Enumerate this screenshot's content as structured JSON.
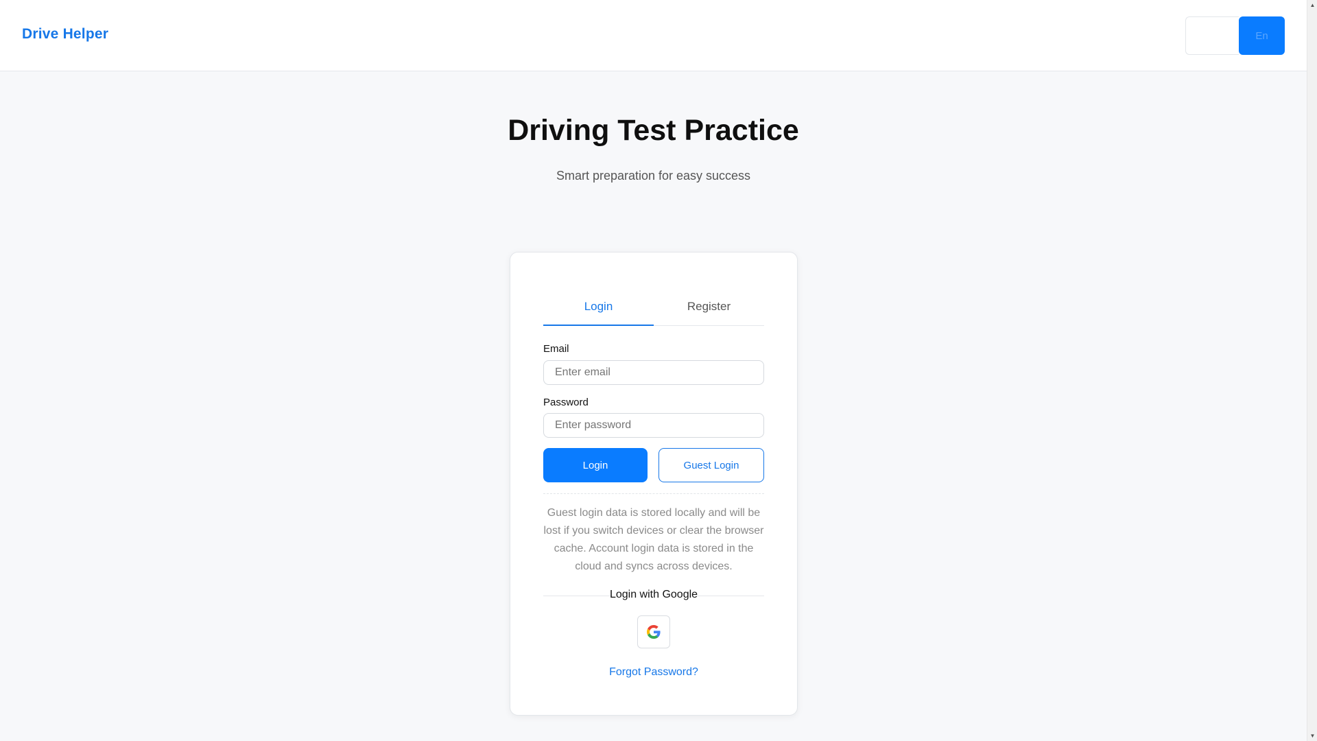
{
  "header": {
    "brand": "Drive Helper",
    "lang_inactive_label": "",
    "lang_active_label": "En"
  },
  "hero": {
    "title": "Driving Test Practice",
    "subtitle": "Smart preparation for easy success"
  },
  "auth_card": {
    "tabs": [
      {
        "label": "Login",
        "active": true
      },
      {
        "label": "Register",
        "active": false
      }
    ],
    "email_label": "Email",
    "email_placeholder": "Enter email",
    "email_value": "",
    "password_label": "Password",
    "password_placeholder": "Enter password",
    "password_value": "",
    "login_button": "Login",
    "guest_login_button": "Guest Login",
    "notice": "Guest login data is stored locally and will be lost if you switch devices or clear the browser cache. Account login data is stored in the cloud and syncs across devices.",
    "social_divider": "Login with Google",
    "google_icon": "google-g-icon",
    "forgot_password": "Forgot Password?"
  },
  "colors": {
    "accent": "#1677e8",
    "primary_button": "#0a7cff",
    "background": "#f7f8fa"
  }
}
